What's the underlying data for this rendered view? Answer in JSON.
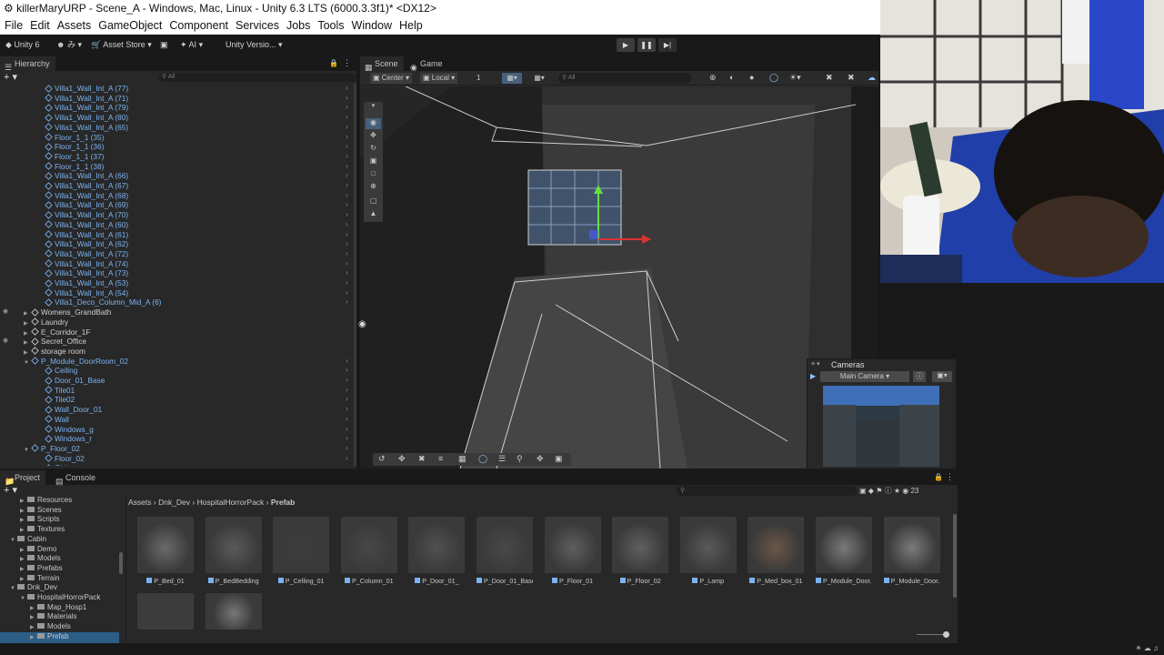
{
  "window": {
    "title": "killerMaryURP - Scene_A - Windows, Mac, Linux - Unity 6.3 LTS (6000.3.3f1)* <DX12>",
    "menu": [
      "File",
      "Edit",
      "Assets",
      "GameObject",
      "Component",
      "Services",
      "Jobs",
      "Tools",
      "Window",
      "Help"
    ]
  },
  "toolbar": {
    "unity_label": "Unity 6",
    "account_label": "み",
    "asset_store": "Asset Store",
    "ai": "AI",
    "version_control": "Unity Versio..."
  },
  "hierarchy": {
    "tab": "Hierarchy",
    "search_placeholder": "All",
    "items": [
      {
        "name": "Villa1_Wall_Int_A (77)",
        "indent": 3,
        "prefab": true
      },
      {
        "name": "Villa1_Wall_Int_A (71)",
        "indent": 3,
        "prefab": true
      },
      {
        "name": "Villa1_Wall_Int_A (79)",
        "indent": 3,
        "prefab": true
      },
      {
        "name": "Villa1_Wall_Int_A (80)",
        "indent": 3,
        "prefab": true
      },
      {
        "name": "Villa1_Wall_Int_A (65)",
        "indent": 3,
        "prefab": true
      },
      {
        "name": "Floor_1_1 (35)",
        "indent": 3,
        "prefab": true
      },
      {
        "name": "Floor_1_1 (36)",
        "indent": 3,
        "prefab": true
      },
      {
        "name": "Floor_1_1 (37)",
        "indent": 3,
        "prefab": true
      },
      {
        "name": "Floor_1_1 (38)",
        "indent": 3,
        "prefab": true
      },
      {
        "name": "Villa1_Wall_Int_A (66)",
        "indent": 3,
        "prefab": true
      },
      {
        "name": "Villa1_Wall_Int_A (67)",
        "indent": 3,
        "prefab": true
      },
      {
        "name": "Villa1_Wall_Int_A (68)",
        "indent": 3,
        "prefab": true
      },
      {
        "name": "Villa1_Wall_Int_A (69)",
        "indent": 3,
        "prefab": true
      },
      {
        "name": "Villa1_Wall_Int_A (70)",
        "indent": 3,
        "prefab": true
      },
      {
        "name": "Villa1_Wall_Int_A (60)",
        "indent": 3,
        "prefab": true
      },
      {
        "name": "Villa1_Wall_Int_A (61)",
        "indent": 3,
        "prefab": true
      },
      {
        "name": "Villa1_Wall_Int_A (62)",
        "indent": 3,
        "prefab": true
      },
      {
        "name": "Villa1_Wall_Int_A (72)",
        "indent": 3,
        "prefab": true
      },
      {
        "name": "Villa1_Wall_Int_A (74)",
        "indent": 3,
        "prefab": true
      },
      {
        "name": "Villa1_Wall_Int_A (73)",
        "indent": 3,
        "prefab": true
      },
      {
        "name": "Villa1_Wall_Int_A (53)",
        "indent": 3,
        "prefab": true
      },
      {
        "name": "Villa1_Wall_Int_A (54)",
        "indent": 3,
        "prefab": true
      },
      {
        "name": "Villa1_Deco_Column_Mid_A (6)",
        "indent": 3,
        "prefab": true
      },
      {
        "name": "Womens_GrandBath",
        "indent": 2,
        "prefab": false,
        "arrow": "▶"
      },
      {
        "name": "Laundry",
        "indent": 2,
        "prefab": false,
        "arrow": "▶"
      },
      {
        "name": "E_Corridor_1F",
        "indent": 2,
        "prefab": false,
        "arrow": "▶"
      },
      {
        "name": "Secret_Office",
        "indent": 2,
        "prefab": false,
        "arrow": "▶"
      },
      {
        "name": "storage room",
        "indent": 2,
        "prefab": false,
        "arrow": "▶"
      },
      {
        "name": "P_Module_DoorRoom_02",
        "indent": 2,
        "prefab": true,
        "arrow": "▼"
      },
      {
        "name": "Ceiling",
        "indent": 3,
        "prefab": true
      },
      {
        "name": "Door_01_Base",
        "indent": 3,
        "prefab": true
      },
      {
        "name": "Tile01",
        "indent": 3,
        "prefab": true
      },
      {
        "name": "Tile02",
        "indent": 3,
        "prefab": true
      },
      {
        "name": "Wall_Door_01",
        "indent": 3,
        "prefab": true
      },
      {
        "name": "Wall",
        "indent": 3,
        "prefab": true
      },
      {
        "name": "Windows_g",
        "indent": 3,
        "prefab": true
      },
      {
        "name": "Windows_r",
        "indent": 3,
        "prefab": true
      },
      {
        "name": "P_Floor_02",
        "indent": 2,
        "prefab": true,
        "arrow": "▼"
      },
      {
        "name": "Floor_02",
        "indent": 3,
        "prefab": true
      },
      {
        "name": "Object",
        "indent": 3,
        "prefab": true
      }
    ]
  },
  "scene": {
    "tab_scene": "Scene",
    "tab_game": "Game",
    "pivot": "Center",
    "space": "Local",
    "grid_snap": "1",
    "search_placeholder": "All"
  },
  "cameras": {
    "title": "Cameras",
    "selected": "Main Camera"
  },
  "project": {
    "tab_project": "Project",
    "tab_console": "Console",
    "breadcrumb": [
      "Assets",
      "Dnk_Dev",
      "HospitalHorrorPack",
      "Prefab"
    ],
    "count": "23",
    "folders": [
      {
        "name": "Resources",
        "indent": 2
      },
      {
        "name": "Scenes",
        "indent": 2
      },
      {
        "name": "Scripts",
        "indent": 2
      },
      {
        "name": "Textures",
        "indent": 2
      },
      {
        "name": "Cabin",
        "indent": 1,
        "open": true
      },
      {
        "name": "Demo",
        "indent": 2
      },
      {
        "name": "Models",
        "indent": 2
      },
      {
        "name": "Prefabs",
        "indent": 2
      },
      {
        "name": "Terrain",
        "indent": 2
      },
      {
        "name": "Dnk_Dev",
        "indent": 1,
        "open": true
      },
      {
        "name": "HospitalHorrorPack",
        "indent": 2,
        "open": true
      },
      {
        "name": "Map_Hosp1",
        "indent": 3
      },
      {
        "name": "Materials",
        "indent": 3
      },
      {
        "name": "Models",
        "indent": 3
      },
      {
        "name": "Prefab",
        "indent": 3,
        "selected": true
      }
    ],
    "assets": [
      "P_Bed_01",
      "P_BedBedding",
      "P_Celling_01",
      "P_Column_01",
      "P_Door_01_",
      "P_Door_01_Base",
      "P_Floor_01",
      "P_Floor_02",
      "P_Lamp",
      "P_Med_box_01",
      "P_Module_Door...",
      "P_Module_Door..."
    ]
  },
  "colors": {
    "accent_blue": "#7bb3f2",
    "panel": "#282828",
    "background": "#191919"
  }
}
